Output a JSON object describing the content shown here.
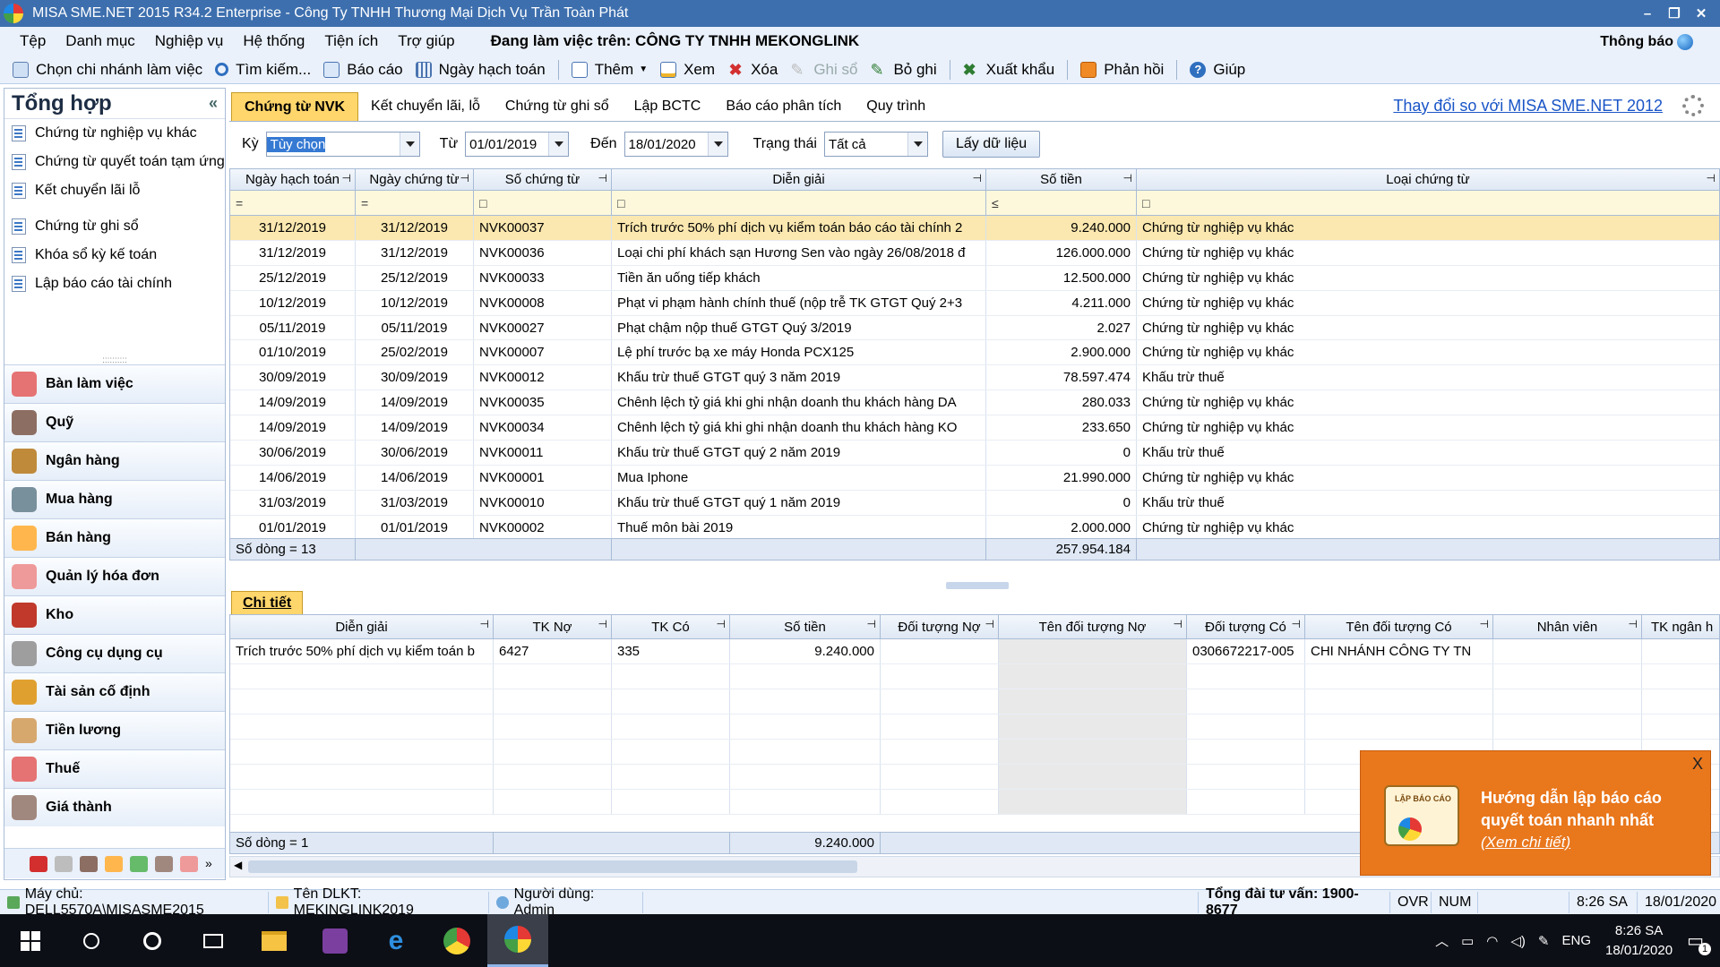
{
  "window": {
    "title": "MISA SME.NET 2015 R34.2 Enterprise - Công Ty TNHH Thương Mại Dịch Vụ Trần Toàn Phát"
  },
  "menu": {
    "items": [
      "Tệp",
      "Danh mục",
      "Nghiệp vụ",
      "Hệ thống",
      "Tiện ích",
      "Trợ giúp"
    ],
    "working_on": "Đang làm việc trên: CÔNG TY TNHH MEKONGLINK",
    "notifications": "Thông báo"
  },
  "toolbar": {
    "branch": "Chọn chi nhánh làm việc",
    "search": "Tìm kiếm...",
    "report": "Báo cáo",
    "posting_date": "Ngày hạch toán",
    "add": "Thêm",
    "view": "Xem",
    "delete": "Xóa",
    "post": "Ghi sổ",
    "unpost": "Bỏ ghi",
    "export": "Xuất khẩu",
    "feedback": "Phản hồi",
    "help": "Giúp"
  },
  "sidebar": {
    "title": "Tổng hợp",
    "items1": [
      "Chứng từ nghiệp vụ khác",
      "Chứng từ quyết toán tạm ứng",
      "Kết chuyển lãi lỗ"
    ],
    "items2": [
      "Chứng từ ghi sổ",
      "Khóa sổ kỳ kế toán",
      "Lập báo cáo tài chính"
    ],
    "modules": [
      "Bàn làm việc",
      "Quỹ",
      "Ngân hàng",
      "Mua hàng",
      "Bán hàng",
      "Quản lý hóa đơn",
      "Kho",
      "Công cụ dụng cụ",
      "Tài sản cố định",
      "Tiền lương",
      "Thuế",
      "Giá thành"
    ]
  },
  "tabs": {
    "items": [
      "Chứng từ NVK",
      "Kết chuyển lãi, lỗ",
      "Chứng từ ghi sổ",
      "Lập BCTC",
      "Báo cáo phân tích",
      "Quy trình"
    ],
    "compare_link": "Thay đổi so với MISA SME.NET 2012"
  },
  "filter": {
    "period_label": "Kỳ",
    "period_value": "Tùy chọn",
    "from_label": "Từ",
    "from_value": "01/01/2019",
    "to_label": "Đến",
    "to_value": "18/01/2020",
    "status_label": "Trạng thái",
    "status_value": "Tất cả",
    "fetch_button": "Lấy dữ liệu"
  },
  "grid": {
    "headers": [
      "Ngày hạch toán",
      "Ngày chứng từ",
      "Số chứng từ",
      "Diễn giải",
      "Số tiền",
      "Loại chứng từ"
    ],
    "filter_symbols": [
      "=",
      "=",
      "□",
      "□",
      "≤",
      "□"
    ],
    "rows": [
      [
        "31/12/2019",
        "31/12/2019",
        "NVK00037",
        "Trích trước 50% phí dịch vụ kiểm toán báo cáo tài chính 2",
        "9.240.000",
        "Chứng từ nghiệp vụ khác"
      ],
      [
        "31/12/2019",
        "31/12/2019",
        "NVK00036",
        "Loại chi phí khách sạn Hương Sen vào ngày 26/08/2018 đ",
        "126.000.000",
        "Chứng từ nghiệp vụ khác"
      ],
      [
        "25/12/2019",
        "25/12/2019",
        "NVK00033",
        "Tiền ăn uống tiếp khách",
        "12.500.000",
        "Chứng từ nghiệp vụ khác"
      ],
      [
        "10/12/2019",
        "10/12/2019",
        "NVK00008",
        "Phạt vi phạm hành chính thuế (nộp trễ TK GTGT Quý 2+3",
        "4.211.000",
        "Chứng từ nghiệp vụ khác"
      ],
      [
        "05/11/2019",
        "05/11/2019",
        "NVK00027",
        "Phạt chậm nộp thuế GTGT Quý 3/2019",
        "2.027",
        "Chứng từ nghiệp vụ khác"
      ],
      [
        "01/10/2019",
        "25/02/2019",
        "NVK00007",
        "Lệ phí trước bạ xe máy Honda PCX125",
        "2.900.000",
        "Chứng từ nghiệp vụ khác"
      ],
      [
        "30/09/2019",
        "30/09/2019",
        "NVK00012",
        "Khấu trừ thuế GTGT quý 3 năm 2019",
        "78.597.474",
        "Khấu trừ thuế"
      ],
      [
        "14/09/2019",
        "14/09/2019",
        "NVK00035",
        "Chênh lệch tỷ giá khi ghi nhận doanh thu khách hàng DA",
        "280.033",
        "Chứng từ nghiệp vụ khác"
      ],
      [
        "14/09/2019",
        "14/09/2019",
        "NVK00034",
        "Chênh lệch tỷ giá khi ghi nhận doanh thu khách hàng KO",
        "233.650",
        "Chứng từ nghiệp vụ khác"
      ],
      [
        "30/06/2019",
        "30/06/2019",
        "NVK00011",
        "Khấu trừ thuế GTGT quý 2 năm 2019",
        "0",
        "Khấu trừ thuế"
      ],
      [
        "14/06/2019",
        "14/06/2019",
        "NVK00001",
        "Mua Iphone",
        "21.990.000",
        "Chứng từ nghiệp vụ khác"
      ],
      [
        "31/03/2019",
        "31/03/2019",
        "NVK00010",
        "Khấu trừ thuế GTGT quý 1 năm 2019",
        "0",
        "Khấu trừ thuế"
      ],
      [
        "01/01/2019",
        "01/01/2019",
        "NVK00002",
        "Thuế môn bài 2019",
        "2.000.000",
        "Chứng từ nghiệp vụ khác"
      ]
    ],
    "row_count": "Số dòng = 13",
    "total": "257.954.184"
  },
  "detail": {
    "tab": "Chi tiết",
    "headers": [
      "Diễn giải",
      "TK Nợ",
      "TK Có",
      "Số tiền",
      "Đối tượng Nợ",
      "Tên đối tượng Nợ",
      "Đối tượng Có",
      "Tên đối tượng Có",
      "Nhân viên",
      "TK ngân h"
    ],
    "rows": [
      [
        "Trích trước 50% phí dịch vụ kiểm toán b",
        "6427",
        "335",
        "9.240.000",
        "",
        "",
        "0306672217-005",
        "CHI NHÁNH CÔNG TY TN",
        "",
        ""
      ]
    ],
    "row_count": "Số dòng = 1",
    "total": "9.240.000"
  },
  "popup": {
    "line1": "Hướng dẫn lập báo cáo",
    "line2": "quyết toán nhanh nhất",
    "link": "(Xem chi tiết)",
    "icon_text": "LẬP BÁO CÁO",
    "close": "X"
  },
  "status": {
    "server": "Máy chủ: DELL5570A\\MISASME2015",
    "db": "Tên DLKT: MEKINGLINK2019",
    "user": "Người dùng: Admin",
    "hotline": "Tổng đài tư vấn: 1900-8677",
    "ovr": "OVR",
    "num": "NUM",
    "time": "8:26 SA",
    "date": "18/01/2020"
  },
  "taskbar": {
    "lang": "ENG",
    "time": "8:26 SA",
    "date": "18/01/2020",
    "notif_count": "1"
  }
}
